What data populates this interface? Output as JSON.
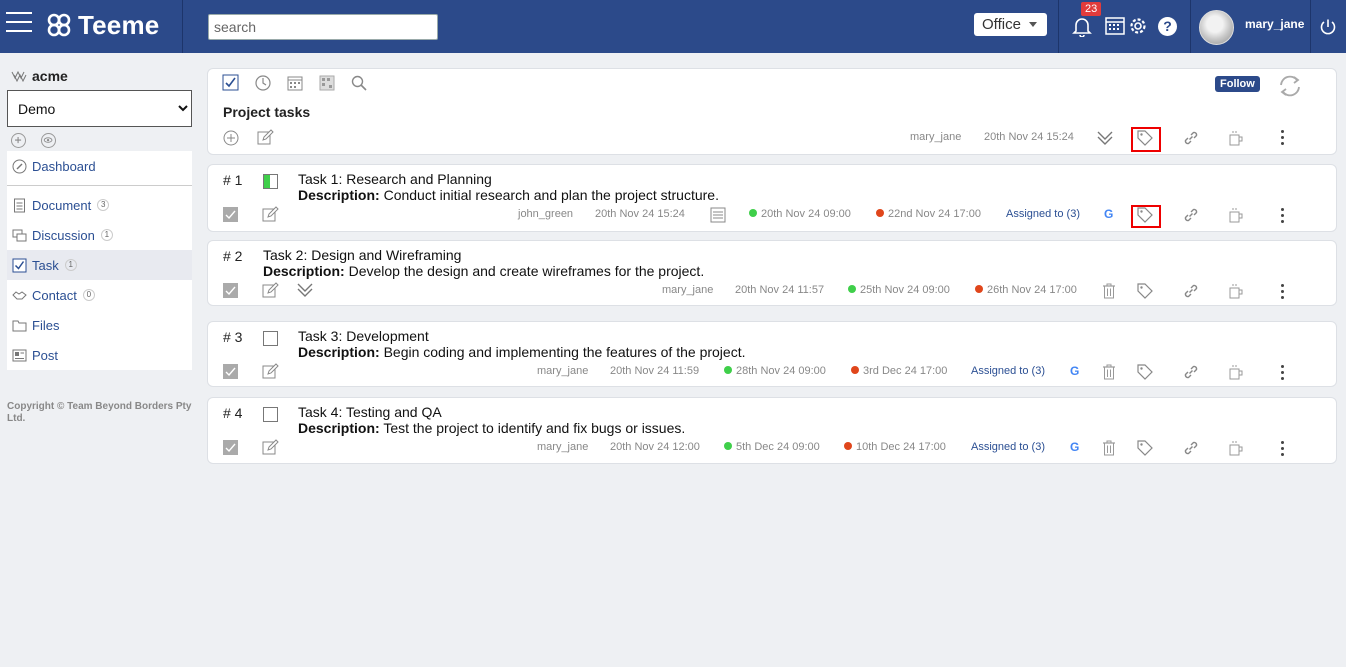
{
  "app": {
    "name": "Teeme"
  },
  "header": {
    "search_placeholder": "search",
    "office_label": "Office",
    "notification_count": "23",
    "help_label": "?",
    "username": "mary_jane"
  },
  "sidebar": {
    "org_name": "acme",
    "workspace_selected": "Demo",
    "items": [
      {
        "label": "Dashboard",
        "icon": "dashboard-icon"
      },
      {
        "label": "Document",
        "count": "3",
        "icon": "document-icon"
      },
      {
        "label": "Discussion",
        "count": "1",
        "icon": "discussion-icon"
      },
      {
        "label": "Task",
        "count": "1",
        "icon": "task-icon",
        "active": true
      },
      {
        "label": "Contact",
        "count": "0",
        "icon": "contact-icon"
      },
      {
        "label": "Files",
        "icon": "folder-icon"
      },
      {
        "label": "Post",
        "icon": "post-icon"
      }
    ],
    "copyright": "Copyright © Team Beyond Borders Pty Ltd."
  },
  "project": {
    "follow_label": "Follow",
    "title": "Project tasks",
    "user": "mary_jane",
    "date": "20th Nov 24 15:24"
  },
  "tasks": [
    {
      "number": "# 1",
      "title": "Task 1: Research and Planning",
      "description_label": "Description:",
      "description": "Conduct initial research and plan the project structure.",
      "user": "john_green",
      "created": "20th Nov 24 15:24",
      "start": "20th Nov 24 09:00",
      "end": "22nd Nov 24 17:00",
      "assigned": "Assigned to (3)",
      "google_label": "G"
    },
    {
      "number": "# 2",
      "title": "Task 2: Design and Wireframing",
      "description_label": "Description:",
      "description": "Develop the design and create wireframes for the project.",
      "user": "mary_jane",
      "created": "20th Nov 24 11:57",
      "start": "25th Nov 24 09:00",
      "end": "26th Nov 24 17:00"
    },
    {
      "number": "# 3",
      "title": "Task 3: Development",
      "description_label": "Description:",
      "description": "Begin coding and implementing the features of the project.",
      "user": "mary_jane",
      "created": "20th Nov 24 11:59",
      "start": "28th Nov 24 09:00",
      "end": "3rd Dec 24 17:00",
      "assigned": "Assigned to (3)",
      "google_label": "G"
    },
    {
      "number": "# 4",
      "title": "Task 4: Testing and QA",
      "description_label": "Description:",
      "description": "Test the project to identify and fix bugs or issues.",
      "user": "mary_jane",
      "created": "20th Nov 24 12:00",
      "start": "5th Dec 24 09:00",
      "end": "10th Dec 24 17:00",
      "assigned": "Assigned to (3)",
      "google_label": "G"
    }
  ],
  "colors": {
    "header_bg": "#2c4a8a",
    "link": "#2b4f93",
    "start_dot": "#3fcf4a",
    "end_dot": "#e0461b",
    "highlight": "#e00000"
  }
}
